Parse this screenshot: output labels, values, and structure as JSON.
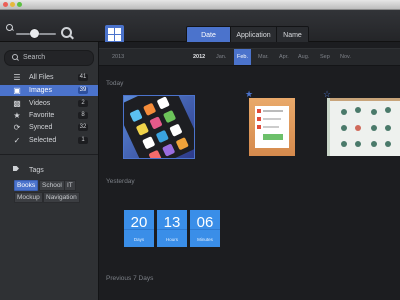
{
  "toolbar": {
    "tabs": [
      {
        "label": "Date",
        "active": true
      },
      {
        "label": "Application",
        "active": false
      },
      {
        "label": "Name",
        "active": false
      }
    ],
    "zoom_level": 0.35,
    "accent_color": "#4b73cc"
  },
  "sidebar": {
    "search_placeholder": "Search",
    "items": [
      {
        "label": "All Files",
        "count": "41",
        "icon": "stack-icon"
      },
      {
        "label": "Images",
        "count": "39",
        "icon": "image-icon",
        "selected": true
      },
      {
        "label": "Videos",
        "count": "2",
        "icon": "film-icon"
      },
      {
        "label": "Favorite",
        "count": "8",
        "icon": "star-icon"
      },
      {
        "label": "Synced",
        "count": "32",
        "icon": "sync-icon"
      },
      {
        "label": "Selected",
        "count": "1",
        "icon": "check-icon"
      }
    ],
    "tags_title": "Tags",
    "tags": [
      {
        "label": "Books",
        "selected": true
      },
      {
        "label": "School"
      },
      {
        "label": "IT"
      },
      {
        "label": "Mockup"
      },
      {
        "label": "Navigation"
      }
    ]
  },
  "timeline": {
    "start_year": "2013",
    "year": "2012",
    "months": [
      "Jan.",
      "Feb.",
      "Mar.",
      "Apr.",
      "Aug.",
      "Sep",
      "Nov."
    ],
    "active_month": "Feb."
  },
  "sections": {
    "today": "Today",
    "yesterday": "Yesterday",
    "previous": "Previous 7 Days"
  },
  "countdown": [
    {
      "value": "20",
      "unit": "Days"
    },
    {
      "value": "13",
      "unit": "Hours"
    },
    {
      "value": "06",
      "unit": "Minutes"
    }
  ]
}
